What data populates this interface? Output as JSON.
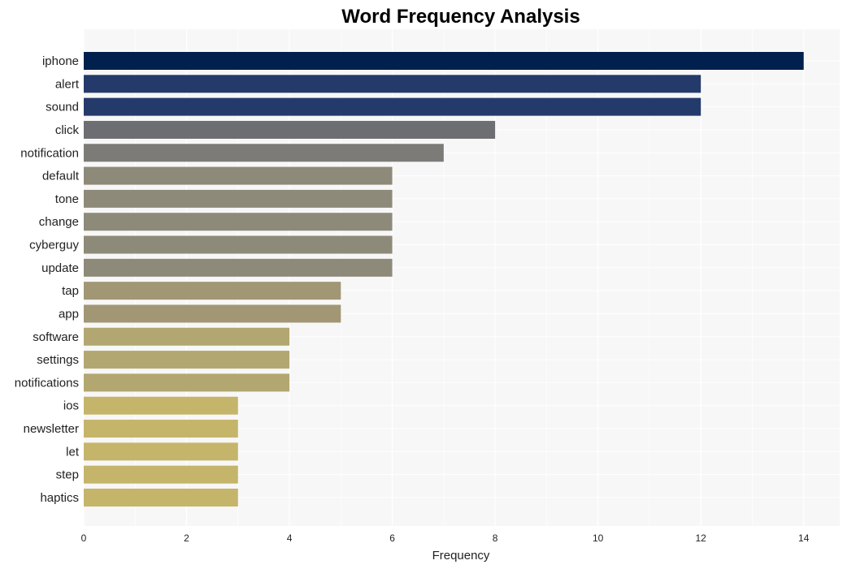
{
  "chart_data": {
    "type": "bar",
    "orientation": "horizontal",
    "title": "Word Frequency Analysis",
    "xlabel": "Frequency",
    "ylabel": "",
    "xlim": [
      0,
      14.7
    ],
    "xticks": [
      0,
      2,
      4,
      6,
      8,
      10,
      12,
      14
    ],
    "grid": true,
    "legend": "none",
    "categories": [
      "iphone",
      "alert",
      "sound",
      "click",
      "notification",
      "default",
      "tone",
      "change",
      "cyberguy",
      "update",
      "tap",
      "app",
      "software",
      "settings",
      "notifications",
      "ios",
      "newsletter",
      "let",
      "step",
      "haptics"
    ],
    "values": [
      14,
      12,
      12,
      8,
      7,
      6,
      6,
      6,
      6,
      6,
      5,
      5,
      4,
      4,
      4,
      3,
      3,
      3,
      3,
      3
    ],
    "colors": [
      "#00204e",
      "#233a6b",
      "#233a6b",
      "#6d6e72",
      "#7d7b77",
      "#8e8a7a",
      "#8e8a7a",
      "#8e8a7a",
      "#8e8a7a",
      "#8e8a7a",
      "#a19775",
      "#a19775",
      "#b2a770",
      "#b2a770",
      "#b2a770",
      "#c5b56b",
      "#c5b56b",
      "#c5b56b",
      "#c5b56b",
      "#c5b56b"
    ]
  }
}
